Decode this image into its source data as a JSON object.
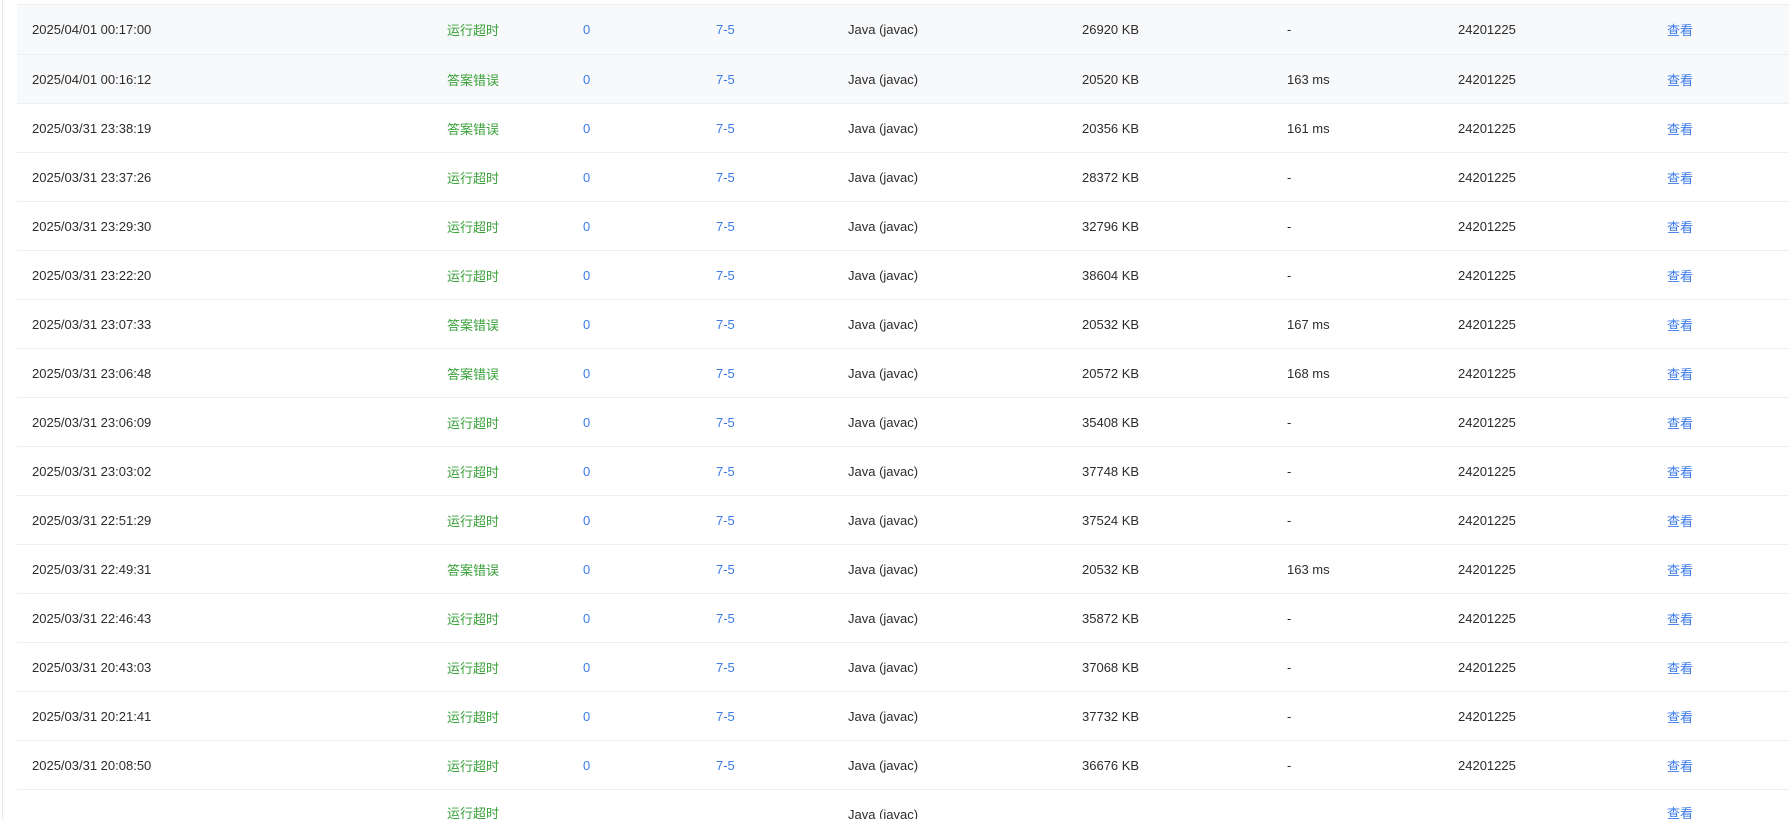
{
  "submissions": [
    {
      "time": "2025/04/01 00:17:00",
      "status": "运行超时",
      "score": "0",
      "problem": "7-5",
      "language": "Java (javac)",
      "memory": "26920 KB",
      "time_used": "-",
      "user": "24201225",
      "action": "查看"
    },
    {
      "time": "2025/04/01 00:16:12",
      "status": "答案错误",
      "score": "0",
      "problem": "7-5",
      "language": "Java (javac)",
      "memory": "20520 KB",
      "time_used": "163 ms",
      "user": "24201225",
      "action": "查看"
    },
    {
      "time": "2025/03/31 23:38:19",
      "status": "答案错误",
      "score": "0",
      "problem": "7-5",
      "language": "Java (javac)",
      "memory": "20356 KB",
      "time_used": "161 ms",
      "user": "24201225",
      "action": "查看"
    },
    {
      "time": "2025/03/31 23:37:26",
      "status": "运行超时",
      "score": "0",
      "problem": "7-5",
      "language": "Java (javac)",
      "memory": "28372 KB",
      "time_used": "-",
      "user": "24201225",
      "action": "查看"
    },
    {
      "time": "2025/03/31 23:29:30",
      "status": "运行超时",
      "score": "0",
      "problem": "7-5",
      "language": "Java (javac)",
      "memory": "32796 KB",
      "time_used": "-",
      "user": "24201225",
      "action": "查看"
    },
    {
      "time": "2025/03/31 23:22:20",
      "status": "运行超时",
      "score": "0",
      "problem": "7-5",
      "language": "Java (javac)",
      "memory": "38604 KB",
      "time_used": "-",
      "user": "24201225",
      "action": "查看"
    },
    {
      "time": "2025/03/31 23:07:33",
      "status": "答案错误",
      "score": "0",
      "problem": "7-5",
      "language": "Java (javac)",
      "memory": "20532 KB",
      "time_used": "167 ms",
      "user": "24201225",
      "action": "查看"
    },
    {
      "time": "2025/03/31 23:06:48",
      "status": "答案错误",
      "score": "0",
      "problem": "7-5",
      "language": "Java (javac)",
      "memory": "20572 KB",
      "time_used": "168 ms",
      "user": "24201225",
      "action": "查看"
    },
    {
      "time": "2025/03/31 23:06:09",
      "status": "运行超时",
      "score": "0",
      "problem": "7-5",
      "language": "Java (javac)",
      "memory": "35408 KB",
      "time_used": "-",
      "user": "24201225",
      "action": "查看"
    },
    {
      "time": "2025/03/31 23:03:02",
      "status": "运行超时",
      "score": "0",
      "problem": "7-5",
      "language": "Java (javac)",
      "memory": "37748 KB",
      "time_used": "-",
      "user": "24201225",
      "action": "查看"
    },
    {
      "time": "2025/03/31 22:51:29",
      "status": "运行超时",
      "score": "0",
      "problem": "7-5",
      "language": "Java (javac)",
      "memory": "37524 KB",
      "time_used": "-",
      "user": "24201225",
      "action": "查看"
    },
    {
      "time": "2025/03/31 22:49:31",
      "status": "答案错误",
      "score": "0",
      "problem": "7-5",
      "language": "Java (javac)",
      "memory": "20532 KB",
      "time_used": "163 ms",
      "user": "24201225",
      "action": "查看"
    },
    {
      "time": "2025/03/31 22:46:43",
      "status": "运行超时",
      "score": "0",
      "problem": "7-5",
      "language": "Java (javac)",
      "memory": "35872 KB",
      "time_used": "-",
      "user": "24201225",
      "action": "查看"
    },
    {
      "time": "2025/03/31 20:43:03",
      "status": "运行超时",
      "score": "0",
      "problem": "7-5",
      "language": "Java (javac)",
      "memory": "37068 KB",
      "time_used": "-",
      "user": "24201225",
      "action": "查看"
    },
    {
      "time": "2025/03/31 20:21:41",
      "status": "运行超时",
      "score": "0",
      "problem": "7-5",
      "language": "Java (javac)",
      "memory": "37732 KB",
      "time_used": "-",
      "user": "24201225",
      "action": "查看"
    },
    {
      "time": "2025/03/31 20:08:50",
      "status": "运行超时",
      "score": "0",
      "problem": "7-5",
      "language": "Java (javac)",
      "memory": "36676 KB",
      "time_used": "-",
      "user": "24201225",
      "action": "查看"
    }
  ],
  "partial_row": {
    "status": "运行超时",
    "language": "Java (javac)",
    "action": "查看"
  },
  "colors": {
    "accepted_status": "#3aa13a",
    "link": "#3b7ae8",
    "text": "#2c2c2c",
    "row_border": "#eceef2"
  }
}
